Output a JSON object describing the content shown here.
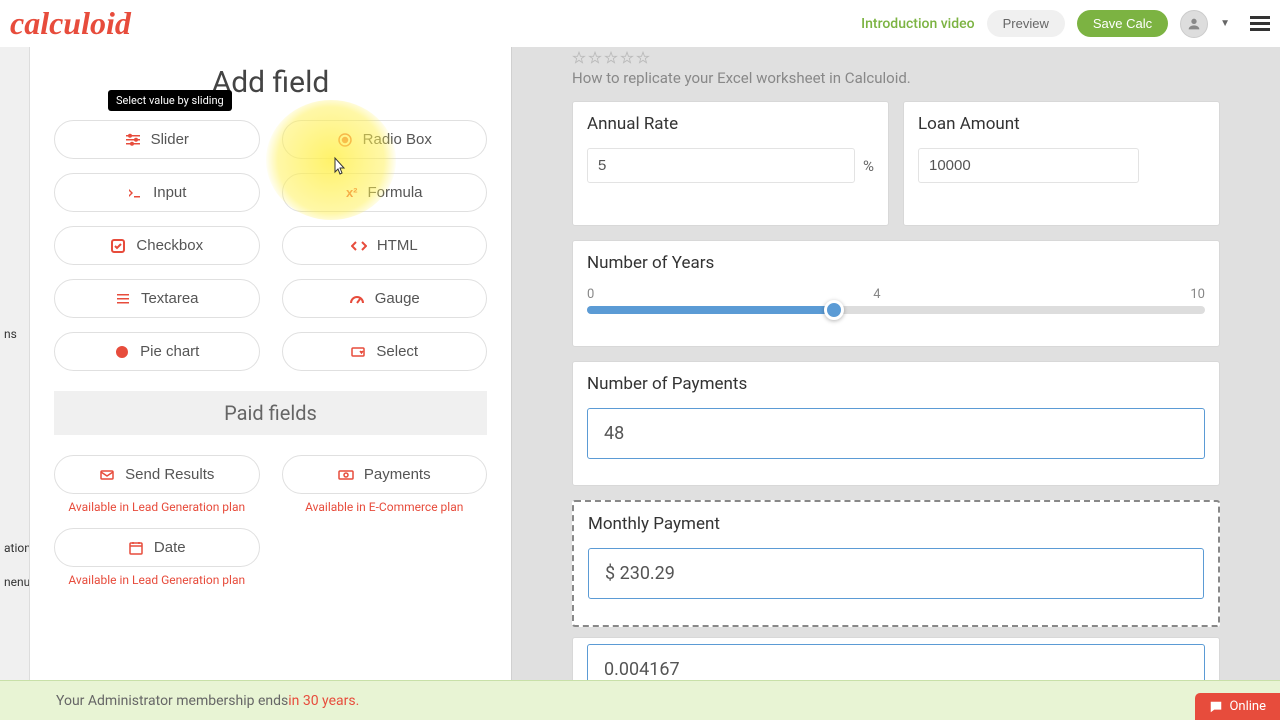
{
  "brand": "calculoid",
  "header": {
    "intro_link": "Introduction video",
    "preview": "Preview",
    "save": "Save Calc"
  },
  "leftPanel": {
    "title": "Add field",
    "tooltip": "Select value by sliding",
    "fields": {
      "slider": "Slider",
      "radio": "Radio Box",
      "input": "Input",
      "formula": "Formula",
      "checkbox": "Checkbox",
      "html": "HTML",
      "textarea": "Textarea",
      "gauge": "Gauge",
      "piechart": "Pie chart",
      "select": "Select"
    },
    "paidHeader": "Paid fields",
    "paid": {
      "sendResults": "Send Results",
      "sendResultsNote": "Available in Lead Generation plan",
      "payments": "Payments",
      "paymentsNote": "Available in E-Commerce plan",
      "date": "Date",
      "dateNote": "Available in Lead Generation plan"
    }
  },
  "sidebar": {
    "item1": "ns",
    "item2": "ation",
    "item3": "nenu"
  },
  "preview": {
    "subtitle": "How to replicate your Excel worksheet in Calculoid.",
    "annualRate": {
      "label": "Annual Rate",
      "value": "5",
      "unit": "%"
    },
    "loanAmount": {
      "label": "Loan Amount",
      "value": "10000"
    },
    "years": {
      "label": "Number of Years",
      "min": "0",
      "mid": "4",
      "max": "10"
    },
    "payments": {
      "label": "Number of Payments",
      "value": "48"
    },
    "monthly": {
      "label": "Monthly Payment",
      "value": "$ 230.29"
    },
    "extra": {
      "value": "0.004167"
    }
  },
  "footer": {
    "text": "Your Administrator membership ends ",
    "highlight": "in 30 years."
  },
  "chat": "Online"
}
